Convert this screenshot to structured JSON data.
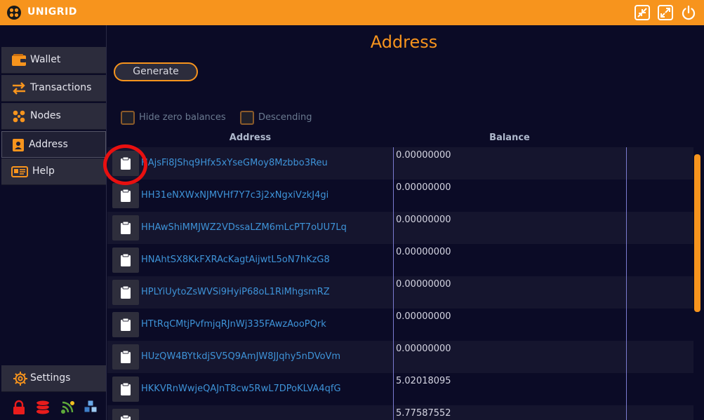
{
  "app": {
    "title": "UNIGRID",
    "brand_color": "#f7941d",
    "window_buttons": [
      "restore-down-icon",
      "maximize-icon",
      "power-icon"
    ]
  },
  "sidebar": {
    "items": [
      {
        "label": "Wallet",
        "icon": "wallet-icon"
      },
      {
        "label": "Transactions",
        "icon": "transfer-arrows-icon"
      },
      {
        "label": "Nodes",
        "icon": "nodes-icon"
      },
      {
        "label": "Address",
        "icon": "address-book-icon",
        "active": true
      },
      {
        "label": "Help",
        "icon": "help-card-icon"
      }
    ],
    "settings": {
      "label": "Settings",
      "icon": "gear-icon"
    },
    "status_icons": [
      "lock-icon",
      "coins-stack-icon",
      "network-signal-icon",
      "blocks-icon"
    ]
  },
  "main": {
    "title": "Address",
    "generate_label": "Generate",
    "filters": {
      "hide_zero": {
        "label": "Hide zero balances",
        "checked": false
      },
      "descending": {
        "label": "Descending",
        "checked": false
      }
    },
    "columns": {
      "address": "Address",
      "balance": "Balance"
    },
    "rows": [
      {
        "address": "HAjsFi8JShq9Hfx5xYseGMoy8Mzbbo3Reu",
        "balance": "0.00000000"
      },
      {
        "address": "HH31eNXWxNJMVHf7Y7c3j2xNgxiVzkJ4gi",
        "balance": "0.00000000"
      },
      {
        "address": "HHAwShiMMJWZ2VDssaLZM6mLcPT7oUU7Lq",
        "balance": "0.00000000"
      },
      {
        "address": "HNAhtSX8KkFXRAcKagtAijwtL5oN7hKzG8",
        "balance": "0.00000000"
      },
      {
        "address": "HPLYiUytoZsWVSi9HyiP68oL1RiMhgsmRZ",
        "balance": "0.00000000"
      },
      {
        "address": "HTtRqCMtjPvfmjqRJnWj335FAwzAooPQrk",
        "balance": "0.00000000"
      },
      {
        "address": "HUzQW4BYtkdjSV5Q9AmJW8JJqhy5nDVoVm",
        "balance": "0.00000000"
      },
      {
        "address": "HKKVRnWwjeQAJnT8cw5RwL7DPoKLVA4qfG",
        "balance": "5.02018095"
      },
      {
        "address": "",
        "balance": "5.77587552"
      }
    ]
  }
}
